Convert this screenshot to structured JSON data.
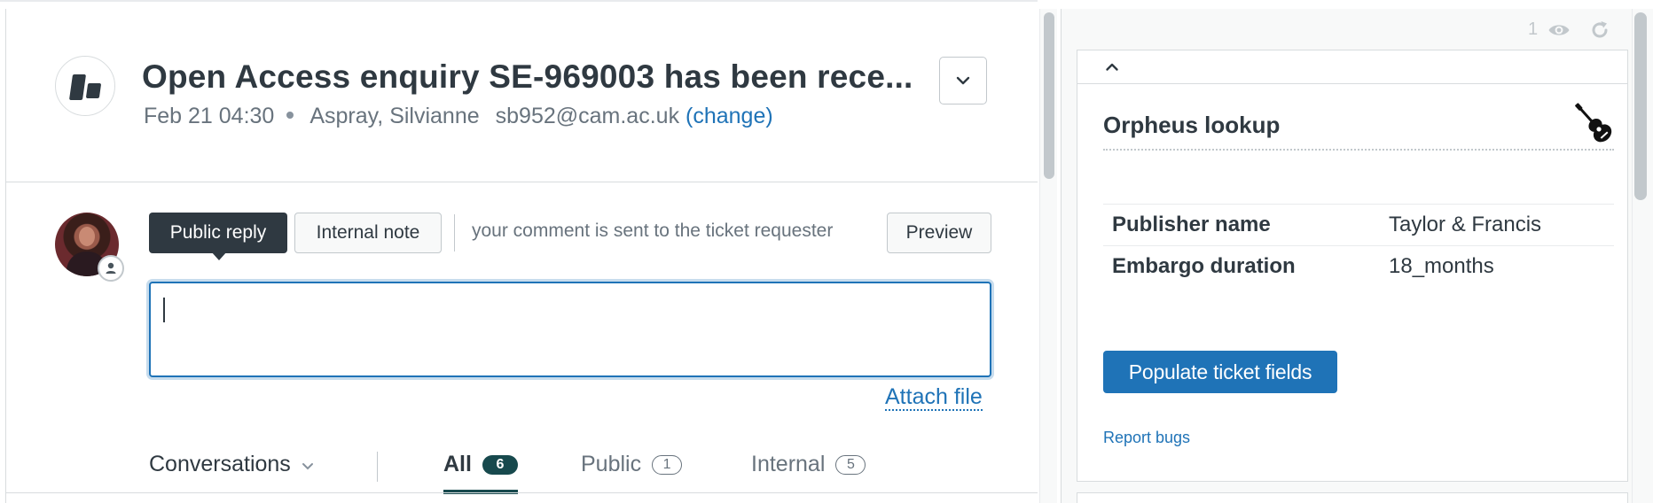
{
  "ticket": {
    "title": "Open Access enquiry SE-969003 has been rece...",
    "date": "Feb 21 04:30",
    "requester_name": "Aspray, Silvianne",
    "requester_email": "sb952@cam.ac.uk",
    "change_label": "(change)"
  },
  "composer": {
    "public_reply_label": "Public reply",
    "internal_note_label": "Internal note",
    "hint": "your comment is sent to the ticket requester",
    "preview_label": "Preview",
    "comment_value": "",
    "attach_file_label": "Attach file"
  },
  "filters": {
    "conversations_label": "Conversations",
    "tabs": [
      {
        "label": "All",
        "count": "6",
        "active": true
      },
      {
        "label": "Public",
        "count": "1",
        "active": false
      },
      {
        "label": "Internal",
        "count": "5",
        "active": false
      }
    ]
  },
  "sidebar": {
    "viewer_count": "1",
    "app": {
      "title": "Orpheus lookup",
      "rows": [
        {
          "key": "Publisher name",
          "value": "Taylor & Francis"
        },
        {
          "key": "Embargo duration",
          "value": "18_months"
        }
      ],
      "populate_label": "Populate ticket fields",
      "report_bugs_label": "Report bugs"
    }
  },
  "icons": {
    "brand_logo": "zendesk-logo",
    "title_menu": "chevron-down-icon",
    "avatar_badge": "person-icon",
    "conversations_dropdown": "chevron-down-icon",
    "viewers": "eye-icon",
    "refresh": "refresh-icon",
    "collapse": "chevron-up-icon",
    "app_icon": "guitar-icon"
  },
  "colors": {
    "text_primary": "#2f3941",
    "text_secondary": "#68737d",
    "link_blue": "#1f73b7",
    "active_tab": "#17494d",
    "border": "#d8dcde",
    "sidebar_bg": "#f8f9f9"
  }
}
